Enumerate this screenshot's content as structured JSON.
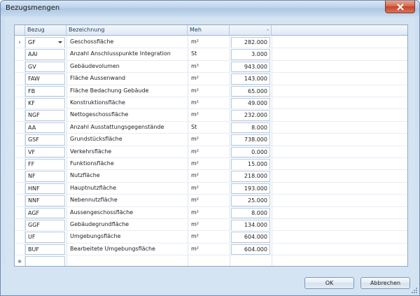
{
  "window": {
    "title": "Bezugsmengen"
  },
  "grid": {
    "columns": {
      "bezug": "Bezug",
      "bezeichnung": "Bezeichnung",
      "meh": "Meh",
      "value": "-"
    },
    "rows": [
      {
        "bezug": "GF",
        "bezeichnung": "Geschossfläche",
        "meh": "m²",
        "value": "282.000"
      },
      {
        "bezug": "AAI",
        "bezeichnung": "Anzahl Anschlusspunkte Integration",
        "meh": "St",
        "value": "3.000"
      },
      {
        "bezug": "GV",
        "bezeichnung": "Gebäudevolumen",
        "meh": "m³",
        "value": "943.000"
      },
      {
        "bezug": "FAW",
        "bezeichnung": "Fläche Aussenwand",
        "meh": "m²",
        "value": "143.000"
      },
      {
        "bezug": "FB",
        "bezeichnung": "Fläche Bedachung Gebäude",
        "meh": "m²",
        "value": "65.000"
      },
      {
        "bezug": "KF",
        "bezeichnung": "Konstruktionsfläche",
        "meh": "m²",
        "value": "49.000"
      },
      {
        "bezug": "NGF",
        "bezeichnung": "Nettogeschossfläche",
        "meh": "m²",
        "value": "232.000"
      },
      {
        "bezug": "AA",
        "bezeichnung": "Anzahl Ausstattungsgegenstände",
        "meh": "St",
        "value": "8.000"
      },
      {
        "bezug": "GSF",
        "bezeichnung": "Grundstücksfläche",
        "meh": "m²",
        "value": "738.000"
      },
      {
        "bezug": "VF",
        "bezeichnung": "Verkehrsfläche",
        "meh": "m²",
        "value": "0.000"
      },
      {
        "bezug": "FF",
        "bezeichnung": "Funktionsfläche",
        "meh": "m²",
        "value": "15.000"
      },
      {
        "bezug": "NF",
        "bezeichnung": "Nutzfläche",
        "meh": "m²",
        "value": "218.000"
      },
      {
        "bezug": "HNF",
        "bezeichnung": "Hauptnutzfläche",
        "meh": "m²",
        "value": "193.000"
      },
      {
        "bezug": "NNF",
        "bezeichnung": "Nebennutzfläche",
        "meh": "m²",
        "value": "25.000"
      },
      {
        "bezug": "AGF",
        "bezeichnung": "Aussengeschossfläche",
        "meh": "m²",
        "value": "8.000"
      },
      {
        "bezug": "GGF",
        "bezeichnung": "Gebäudegrundfläche",
        "meh": "m²",
        "value": "134.000"
      },
      {
        "bezug": "UF",
        "bezeichnung": "Umgebungsfläche",
        "meh": "m²",
        "value": "604.000"
      },
      {
        "bezug": "BUF",
        "bezeichnung": "Bearbeitete Umgebungsfläche",
        "meh": "m²",
        "value": "604.000"
      }
    ],
    "selected_row_indicator": "›",
    "new_row_indicator": "✱"
  },
  "buttons": {
    "ok": "OK",
    "cancel": "Abbrechen"
  },
  "icons": {
    "close": "close-icon",
    "row_pointer": "row-pointer-icon",
    "new_row": "new-row-icon",
    "dropdown": "chevron-down-icon",
    "resize_grip": "resize-grip-icon"
  },
  "colors": {
    "titlebar": "#b9cfe8",
    "close_button": "#c7432a",
    "client_background": "#d5e4f3",
    "grid_header": "#dfe9f5"
  }
}
